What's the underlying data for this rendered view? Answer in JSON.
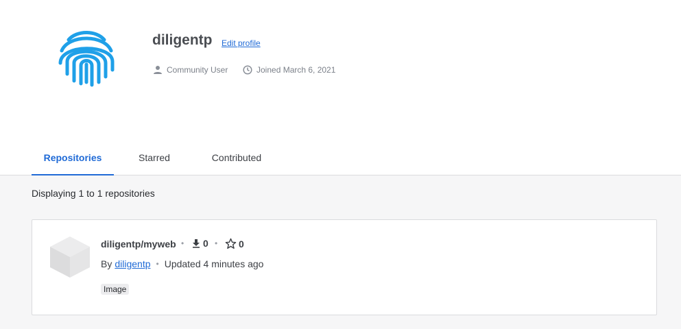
{
  "profile": {
    "username": "diligentp",
    "edit_label": "Edit profile",
    "role": "Community User",
    "joined": "Joined March 6, 2021",
    "accent_color": "#1fa0e8"
  },
  "tabs": [
    {
      "label": "Repositories",
      "active": true
    },
    {
      "label": "Starred",
      "active": false
    },
    {
      "label": "Contributed",
      "active": false
    }
  ],
  "listing": {
    "count_text": "Displaying 1 to 1 repositories"
  },
  "repos": [
    {
      "name": "diligentp/myweb",
      "pulls": "0",
      "stars": "0",
      "by_label": "By",
      "author": "diligentp",
      "updated": "Updated 4 minutes ago",
      "badge": "Image"
    }
  ]
}
